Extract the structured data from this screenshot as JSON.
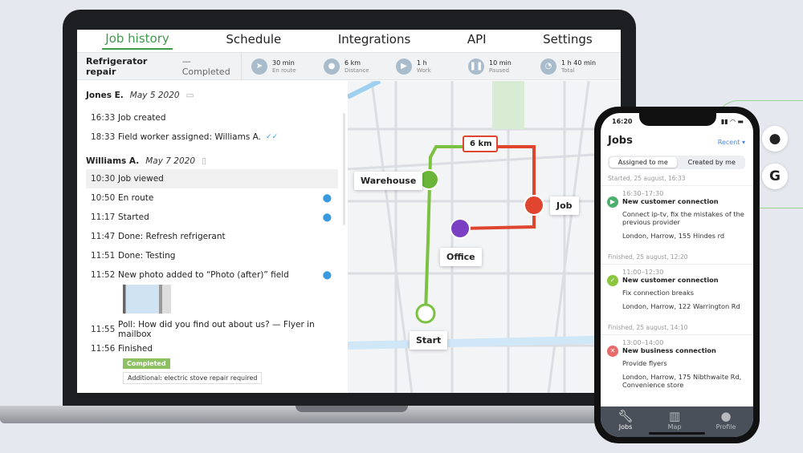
{
  "nav": {
    "tabs": [
      {
        "label": "Job history",
        "active": true
      },
      {
        "label": "Schedule"
      },
      {
        "label": "Integrations"
      },
      {
        "label": "API"
      },
      {
        "label": "Settings"
      }
    ]
  },
  "job": {
    "title": "Refrigerator repair",
    "status": "— Completed"
  },
  "stats": [
    {
      "icon": "navigation-arrow-icon",
      "value": "30 min",
      "label": "En route"
    },
    {
      "icon": "location-pin-icon",
      "value": "6 km",
      "label": "Distance"
    },
    {
      "icon": "play-icon",
      "value": "1 h",
      "label": "Work"
    },
    {
      "icon": "pause-icon",
      "value": "10 min",
      "label": "Paused"
    },
    {
      "icon": "clock-icon",
      "value": "1 h 40 min",
      "label": "Total"
    }
  ],
  "history": {
    "group1": {
      "name": "Jones E.",
      "date": "May 5 2020",
      "device": "desktop-icon",
      "events": [
        {
          "time": "16:33",
          "text": "Job created"
        },
        {
          "time": "18:33",
          "text": "Field worker assigned: Williams A."
        }
      ]
    },
    "group2": {
      "name": "Williams A.",
      "date": "May 7 2020",
      "device": "mobile-icon",
      "events": [
        {
          "time": "10:30",
          "text": "Job viewed"
        },
        {
          "time": "10:50",
          "text": "En route"
        },
        {
          "time": "11:17",
          "text": "Started"
        },
        {
          "time": "11:47",
          "text": "Done: Refresh refrigerant"
        },
        {
          "time": "11:51",
          "text": "Done: Testing"
        },
        {
          "time": "11:52",
          "text": "New photo added to “Photo (after)” field"
        },
        {
          "time": "11:55",
          "text": "Poll: How did you find out about us? — Flyer in mailbox"
        },
        {
          "time": "11:56",
          "text": "Finished"
        }
      ]
    },
    "badge": "Completed",
    "note": "Additional: electric stove repair required"
  },
  "map": {
    "distance": "6 km",
    "labels": {
      "warehouse": "Warehouse",
      "job": "Job",
      "office": "Office",
      "start": "Start"
    },
    "colors": {
      "start_route": "#7cc242",
      "job_route": "#e0452f",
      "office_route": "#7a3fc2"
    }
  },
  "phone": {
    "time": "16:20",
    "title": "Jobs",
    "filter": "Recent ▾",
    "segments": [
      "Assigned to me",
      "Created by me"
    ],
    "sections": [
      {
        "header": "Started, 25 august, 16:33",
        "job": {
          "time": "16:30–17:30",
          "name": "New customer connection",
          "desc": "Connect ip-tv, fix the mistakes of the previous provider",
          "address": "London, Harrow, 155 Hindes rd",
          "status": "started",
          "color": "#4caf6e"
        }
      },
      {
        "header": "Finished, 25 august, 12:20",
        "job": {
          "time": "11:00–12:30",
          "name": "New customer connection",
          "desc": "Fix connection breaks",
          "address": "London, Harrow,  122 Warrington Rd",
          "status": "done",
          "color": "#8cc63f"
        }
      },
      {
        "header": "Finished, 25 august, 14:10",
        "job": {
          "time": "13:00–14:00",
          "name": "New business connection",
          "desc": "Provide flyers",
          "address": "London, Harrow, 175 Nibthwaite Rd, Convenience store",
          "status": "failed",
          "color": "#e86a6a"
        }
      }
    ],
    "nav": [
      "Jobs",
      "Map",
      "Profile"
    ]
  }
}
